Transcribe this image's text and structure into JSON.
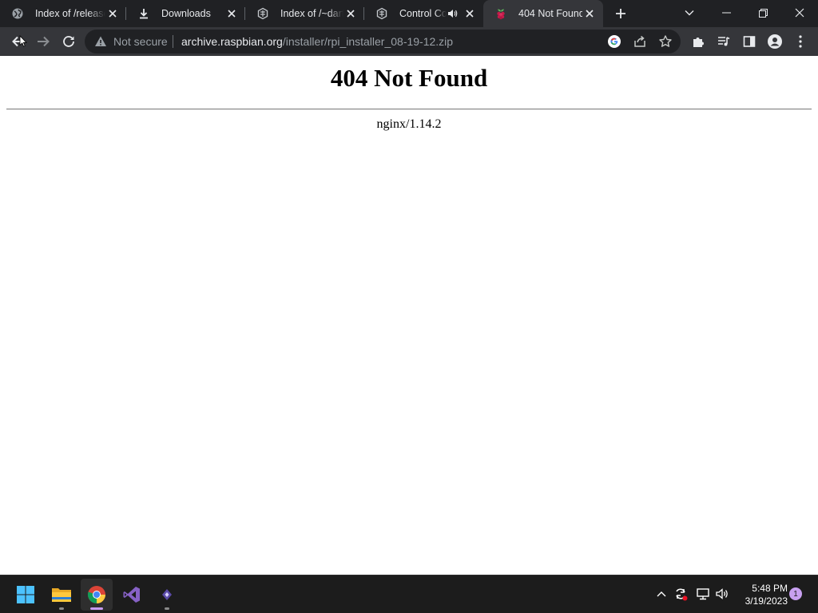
{
  "browser": {
    "tabs": [
      {
        "title": "Index of /releases",
        "icon": "globe-icon",
        "active": false
      },
      {
        "title": "Downloads",
        "icon": "download-icon",
        "active": false
      },
      {
        "title": "Index of /~dartz",
        "icon": "app-icon",
        "active": false
      },
      {
        "title": "Control Coll",
        "icon": "app-icon",
        "active": false,
        "audio": true
      },
      {
        "title": "404 Not Found",
        "icon": "raspberry-icon",
        "active": true
      }
    ],
    "omnibox": {
      "security_label": "Not secure",
      "url_host": "archive.raspbian.org",
      "url_path": "/installer/rpi_installer_08-19-12.zip"
    }
  },
  "page": {
    "heading": "404 Not Found",
    "server": "nginx/1.14.2"
  },
  "taskbar": {
    "time": "5:48 PM",
    "date": "3/19/2023",
    "notification_count": "1"
  },
  "colors": {
    "tabstrip_bg": "#202124",
    "toolbar_bg": "#35363a",
    "taskbar_bg": "#1c1c1c",
    "accent": "#c79bf0"
  }
}
